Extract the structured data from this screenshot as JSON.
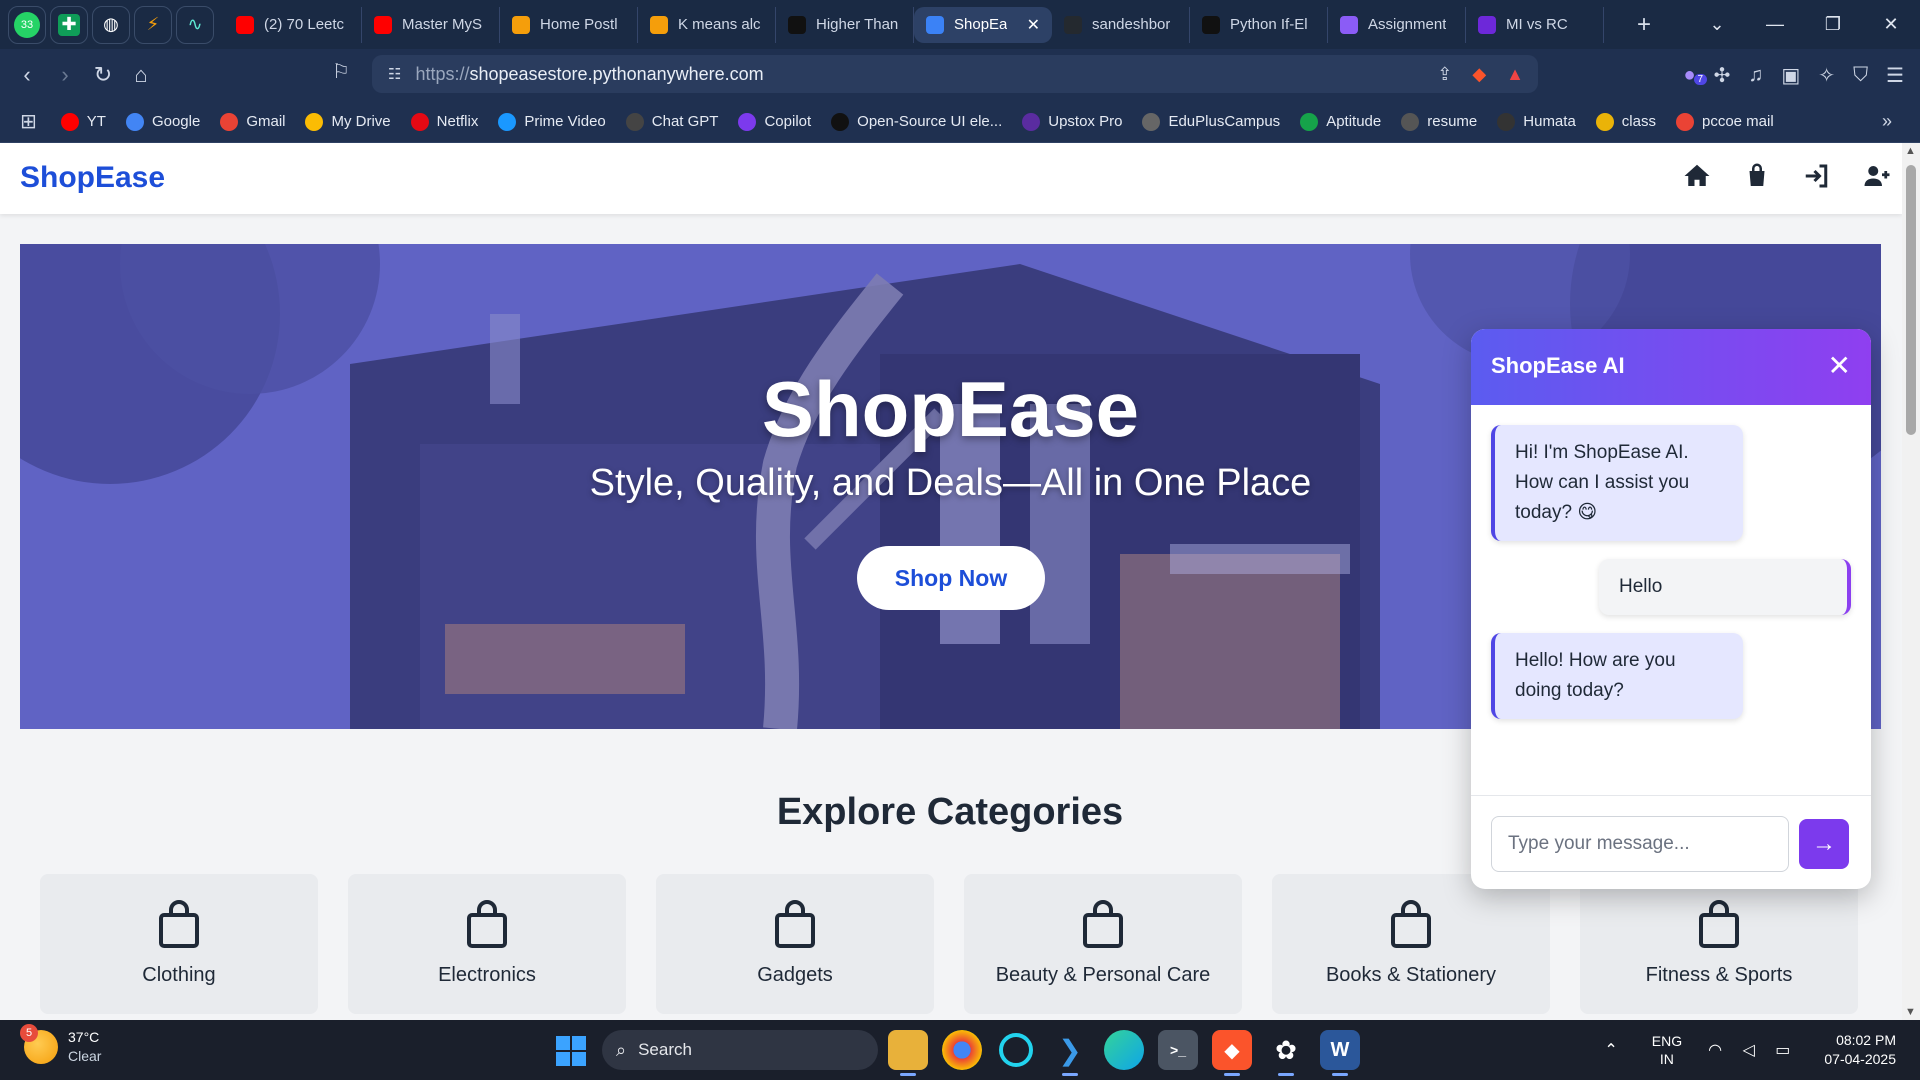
{
  "browser": {
    "pinned_tabs": [
      {
        "name": "whatsapp",
        "badge": "33"
      },
      {
        "name": "sheets"
      },
      {
        "name": "globe"
      },
      {
        "name": "lightning"
      },
      {
        "name": "swirl"
      }
    ],
    "tabs": [
      {
        "label": "(2) 70 Leetc",
        "color": "#ff0000"
      },
      {
        "label": "Master MyS",
        "color": "#ff0000"
      },
      {
        "label": "Home Postl",
        "color": "#f59e0b"
      },
      {
        "label": "K means alc",
        "color": "#f59e0b"
      },
      {
        "label": "Higher Than",
        "color": "#111111"
      },
      {
        "label": "ShopEa",
        "color": "#3b82f6",
        "active": true
      },
      {
        "label": "sandeshbor",
        "color": "#24292f"
      },
      {
        "label": "Python If-El",
        "color": "#111111"
      },
      {
        "label": "Assignment",
        "color": "#8b5cf6"
      },
      {
        "label": "MI vs RC",
        "color": "#6d28d9"
      }
    ],
    "url_scheme": "https://",
    "url_host": "shopeasestore.pythonanywhere.com",
    "extension_badge": "7",
    "bookmarks": [
      {
        "label": "YT",
        "color": "#ff0000"
      },
      {
        "label": "Google",
        "color": "#4285f4"
      },
      {
        "label": "Gmail",
        "color": "#ea4335"
      },
      {
        "label": "My Drive",
        "color": "#fbbc04"
      },
      {
        "label": "Netflix",
        "color": "#e50914"
      },
      {
        "label": "Prime Video",
        "color": "#1a98ff"
      },
      {
        "label": "Chat GPT",
        "color": "#444444"
      },
      {
        "label": "Copilot",
        "color": "#7c3aed"
      },
      {
        "label": "Open-Source UI ele...",
        "color": "#111111"
      },
      {
        "label": "Upstox Pro",
        "color": "#5a2ca0"
      },
      {
        "label": "EduPlusCampus",
        "color": "#666666"
      },
      {
        "label": "Aptitude",
        "color": "#16a34a"
      },
      {
        "label": "resume",
        "color": "#555555"
      },
      {
        "label": "Humata",
        "color": "#333333"
      },
      {
        "label": "class",
        "color": "#eab308"
      },
      {
        "label": "pccoe mail",
        "color": "#ea4335"
      }
    ]
  },
  "site": {
    "brand": "ShopEase",
    "hero_title": "ShopEase",
    "hero_subtitle": "Style, Quality, and Deals—All in One Place",
    "hero_button": "Shop Now",
    "section_title": "Explore Categories",
    "categories": [
      "Clothing",
      "Electronics",
      "Gadgets",
      "Beauty & Personal Care",
      "Books & Stationery",
      "Fitness & Sports"
    ]
  },
  "chat": {
    "title": "ShopEase AI",
    "messages": [
      {
        "from": "bot",
        "text": "Hi! I'm ShopEase AI. How can I assist you today? 😋"
      },
      {
        "from": "user",
        "text": "Hello"
      },
      {
        "from": "bot",
        "text": "Hello! How are you doing today?"
      }
    ],
    "input_placeholder": "Type your message..."
  },
  "taskbar": {
    "weather_badge": "5",
    "temperature": "37°C",
    "condition": "Clear",
    "search_label": "Search",
    "lang_line1": "ENG",
    "lang_line2": "IN",
    "time": "08:02 PM",
    "date": "07-04-2025"
  },
  "colors": {
    "brand": "#1d4ed8",
    "chat_gradient_start": "#5b5cf0",
    "chat_gradient_end": "#8f3ff0"
  }
}
